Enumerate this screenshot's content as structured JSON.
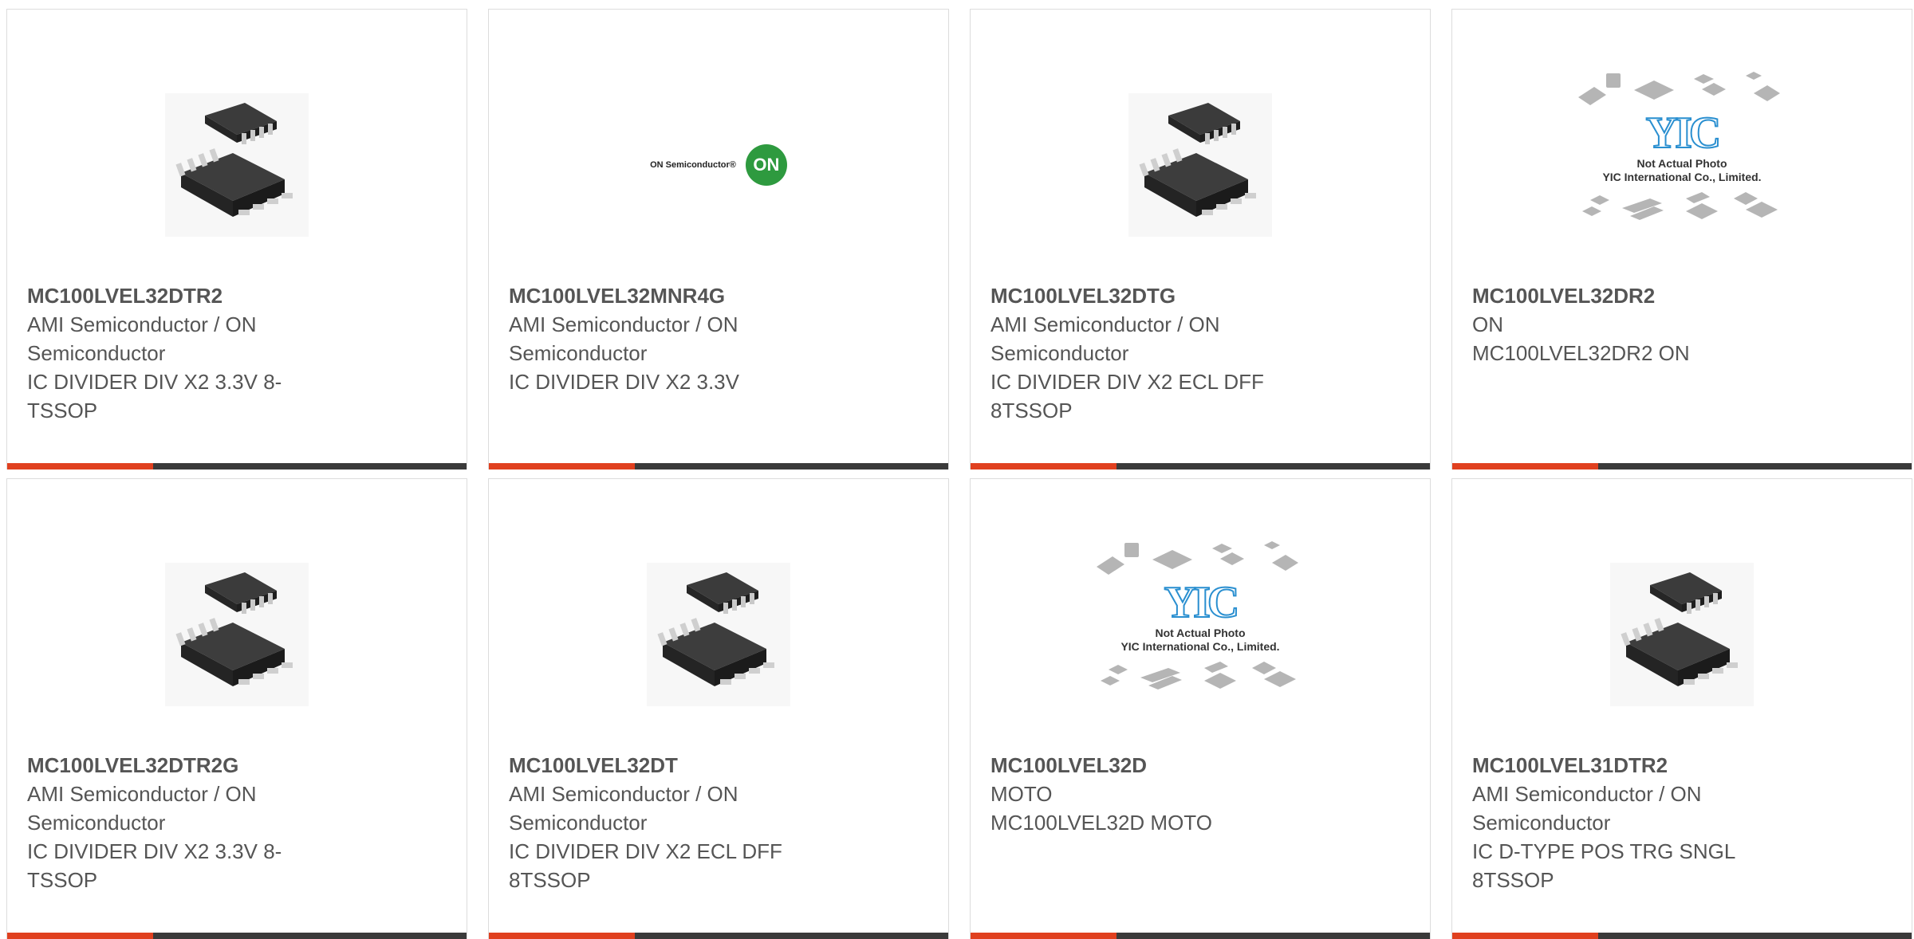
{
  "products": [
    {
      "part": "MC100LVEL32DTR2",
      "brand": "AMI Semiconductor / ON Semiconductor",
      "desc": "IC DIVIDER DIV X2 3.3V 8-TSSOP",
      "image": "tssop-chip"
    },
    {
      "part": "MC100LVEL32MNR4G",
      "brand": "AMI Semiconductor / ON Semiconductor",
      "desc": "IC DIVIDER DIV X2 3.3V",
      "image": "on-semi-logo"
    },
    {
      "part": "MC100LVEL32DTG",
      "brand": "AMI Semiconductor / ON Semiconductor",
      "desc": "IC DIVIDER DIV X2 ECL DFF 8TSSOP",
      "image": "tssop-chip"
    },
    {
      "part": "MC100LVEL32DR2",
      "brand": "ON",
      "desc": "MC100LVEL32DR2 ON",
      "image": "yic-placeholder"
    },
    {
      "part": "MC100LVEL32DTR2G",
      "brand": "AMI Semiconductor / ON Semiconductor",
      "desc": "IC DIVIDER DIV X2 3.3V 8-TSSOP",
      "image": "tssop-chip"
    },
    {
      "part": "MC100LVEL32DT",
      "brand": "AMI Semiconductor / ON Semiconductor",
      "desc": "IC DIVIDER DIV X2 ECL DFF 8TSSOP",
      "image": "tssop-chip"
    },
    {
      "part": "MC100LVEL32D",
      "brand": "MOTO",
      "desc": "MC100LVEL32D MOTO",
      "image": "yic-placeholder"
    },
    {
      "part": "MC100LVEL31DTR2",
      "brand": "AMI Semiconductor / ON Semiconductor",
      "desc": "IC D-TYPE POS TRG SNGL 8TSSOP",
      "image": "tssop-chip"
    }
  ],
  "on_logo": {
    "wordmark": "ON Semiconductor®",
    "badge": "ON"
  },
  "yic_placeholder": {
    "logo": "YIC",
    "line1": "Not Actual Photo",
    "line2": "YIC International Co., Limited."
  },
  "colors": {
    "accent": "#e0401f",
    "bar": "#3a3a3a",
    "on_green": "#2e9a3f",
    "yic_blue": "#2a8fd0"
  }
}
